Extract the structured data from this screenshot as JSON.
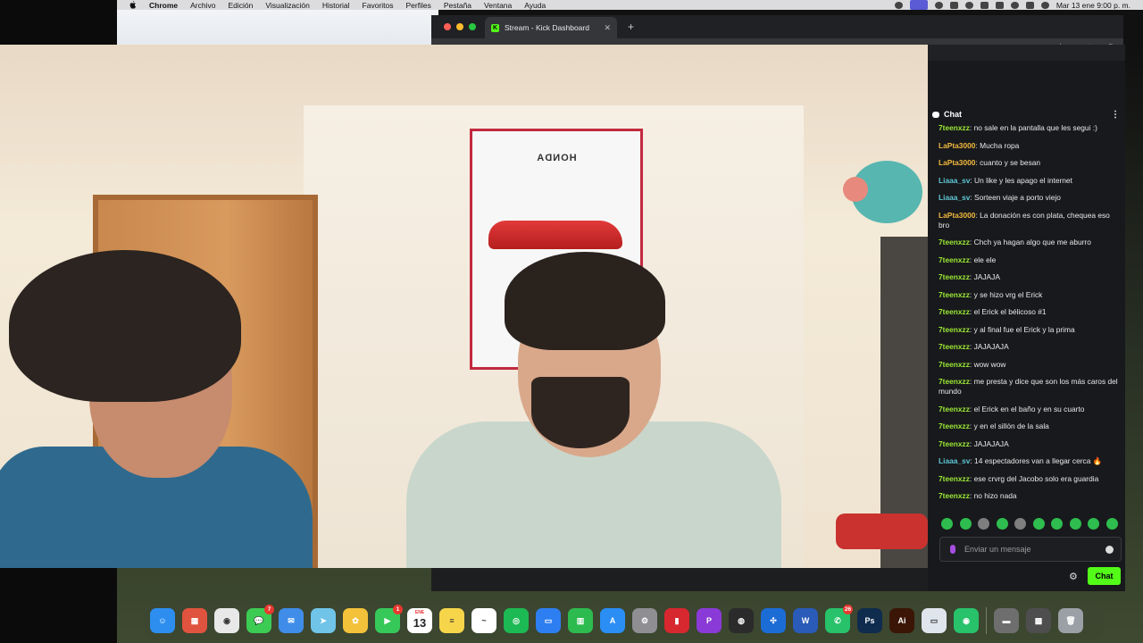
{
  "menubar": {
    "app_name": "Chrome",
    "items": [
      "Archivo",
      "Edición",
      "Visualización",
      "Historial",
      "Favoritos",
      "Perfiles",
      "Pestaña",
      "Ventana",
      "Ayuda"
    ],
    "clock": "Mar 13 ene  9:00 p. m."
  },
  "browser": {
    "tab_title": "Stream - Kick Dashboard",
    "tab_close": "✕",
    "new_tab": "+",
    "star": "☆",
    "mute": "◀×",
    "ext": "▮"
  },
  "poster": {
    "brand": "HONDA"
  },
  "chat": {
    "title": "Chat",
    "messages": [
      {
        "user": "7teenxzz",
        "color": "#9be835",
        "text": "no sale en la pantalla que les segui :)"
      },
      {
        "user": "LaPta3000",
        "color": "#f0b93d",
        "text": "Mucha ropa"
      },
      {
        "user": "LaPta3000",
        "color": "#f0b93d",
        "text": "cuanto y se besan"
      },
      {
        "user": "Liaaa_sv",
        "color": "#5fc7d6",
        "text": "Un like y les apago el internet"
      },
      {
        "user": "Liaaa_sv",
        "color": "#5fc7d6",
        "text": "Sorteen viaje a porto viejo"
      },
      {
        "user": "LaPta3000",
        "color": "#f0b93d",
        "text": "La donación es con plata, chequea eso bro"
      },
      {
        "user": "7teenxzz",
        "color": "#9be835",
        "text": "Chch ya hagan algo que me aburro"
      },
      {
        "user": "7teenxzz",
        "color": "#9be835",
        "text": "ele ele"
      },
      {
        "user": "7teenxzz",
        "color": "#9be835",
        "text": "JAJAJA"
      },
      {
        "user": "7teenxzz",
        "color": "#9be835",
        "text": "y se hizo vrg el Erick"
      },
      {
        "user": "7teenxzz",
        "color": "#9be835",
        "text": "el Erick el bélicoso #1"
      },
      {
        "user": "7teenxzz",
        "color": "#9be835",
        "text": "y al final fue el Erick y la prima"
      },
      {
        "user": "7teenxzz",
        "color": "#9be835",
        "text": "JAJAJAJA"
      },
      {
        "user": "7teenxzz",
        "color": "#9be835",
        "text": "wow wow"
      },
      {
        "user": "7teenxzz",
        "color": "#9be835",
        "text": "me presta y dice que son los más caros del mundo"
      },
      {
        "user": "7teenxzz",
        "color": "#9be835",
        "text": "el Erick en el baño y en su cuarto"
      },
      {
        "user": "7teenxzz",
        "color": "#9be835",
        "text": "y en el sillón de la sala"
      },
      {
        "user": "7teenxzz",
        "color": "#9be835",
        "text": "JAJAJAJA"
      },
      {
        "user": "Liaaa_sv",
        "color": "#5fc7d6",
        "text": "14 espectadores van a llegar cerca 🔥"
      },
      {
        "user": "7teenxzz",
        "color": "#9be835",
        "text": "ese crvrg del Jacobo solo era guardia"
      },
      {
        "user": "7teenxzz",
        "color": "#9be835",
        "text": "no hizo nada"
      }
    ],
    "input_placeholder": "Enviar un mensaje",
    "send_label": "Chat",
    "settings_icon": "⚙"
  },
  "dock": {
    "apps": [
      {
        "name": "finder",
        "label": "☺",
        "color": "#2d8ef0"
      },
      {
        "name": "launchpad",
        "label": "▦",
        "color": "#e0533e"
      },
      {
        "name": "chrome",
        "label": "◉",
        "color": "#e8e8e8"
      },
      {
        "name": "messages",
        "label": "💬",
        "color": "#3ccb53",
        "badge": "7"
      },
      {
        "name": "mail",
        "label": "✉",
        "color": "#3f8de8"
      },
      {
        "name": "maps",
        "label": "➤",
        "color": "#6fc4e8"
      },
      {
        "name": "photos",
        "label": "✿",
        "color": "#f3c13a"
      },
      {
        "name": "facetime",
        "label": "▶",
        "color": "#37c85a",
        "badge": "1"
      },
      {
        "name": "calendar",
        "label": "",
        "color": "#ffffff",
        "month": "ENE",
        "day": "13"
      },
      {
        "name": "notes",
        "label": "≡",
        "color": "#f7d54b"
      },
      {
        "name": "freeform",
        "label": "~",
        "color": "#ffffff"
      },
      {
        "name": "spotify",
        "label": "◎",
        "color": "#1db954"
      },
      {
        "name": "keynote",
        "label": "▭",
        "color": "#2d7ef0"
      },
      {
        "name": "numbers",
        "label": "▥",
        "color": "#2dbb4f"
      },
      {
        "name": "app-store",
        "label": "A",
        "color": "#2a8ef5"
      },
      {
        "name": "system-settings",
        "label": "⚙",
        "color": "#8e8e93"
      },
      {
        "name": "dashlane",
        "label": "▮",
        "color": "#d7272f"
      },
      {
        "name": "pdf-app",
        "label": "P",
        "color": "#8a3ad6"
      },
      {
        "name": "obs",
        "label": "◍",
        "color": "#2b2b2b"
      },
      {
        "name": "game-controller",
        "label": "✣",
        "color": "#1c6cd6"
      },
      {
        "name": "word",
        "label": "W",
        "color": "#2a5bb8"
      },
      {
        "name": "whatsapp",
        "label": "✆",
        "color": "#27c26a",
        "badge": "26"
      },
      {
        "name": "photoshop",
        "label": "Ps",
        "color": "#0f2b4d"
      },
      {
        "name": "illustrator",
        "label": "Ai",
        "color": "#3b1606"
      },
      {
        "name": "preview",
        "label": "▭",
        "color": "#dfe5ec"
      },
      {
        "name": "screen-app",
        "label": "◉",
        "color": "#27c26a"
      },
      {
        "name": "downloads",
        "label": "▬",
        "color": "#6e6e6e"
      },
      {
        "name": "recent-window",
        "label": "▩",
        "color": "#4e4e4e"
      },
      {
        "name": "trash",
        "label": "🗑",
        "color": "#9aa0a6"
      }
    ]
  }
}
